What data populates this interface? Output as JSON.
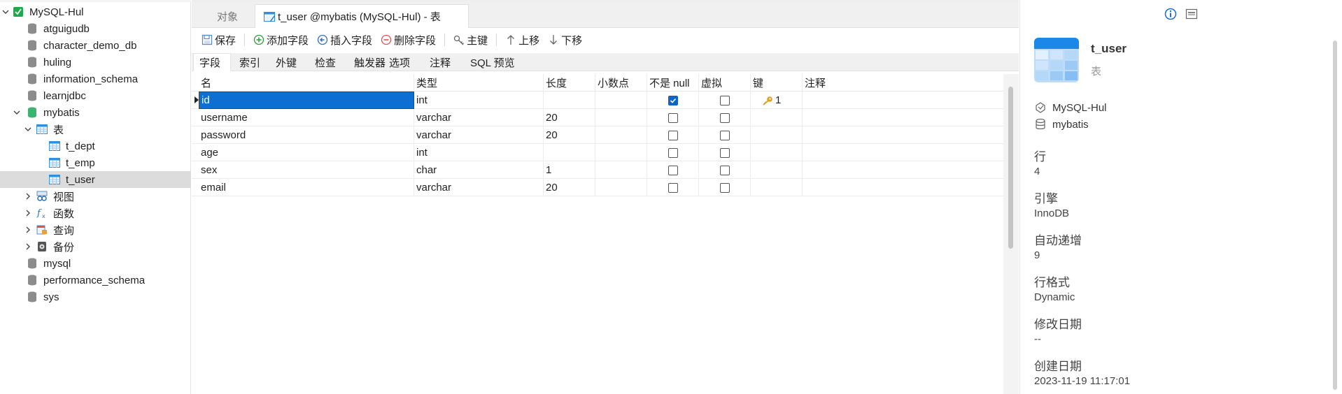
{
  "sidebar": {
    "connection": "MySQL-Hul",
    "items": [
      {
        "label": "atguigudb"
      },
      {
        "label": "character_demo_db"
      },
      {
        "label": "huling"
      },
      {
        "label": "information_schema"
      },
      {
        "label": "learnjdbc"
      },
      {
        "label": "mybatis"
      },
      {
        "label": "表"
      },
      {
        "label": "t_dept"
      },
      {
        "label": "t_emp"
      },
      {
        "label": "t_user"
      },
      {
        "label": "视图"
      },
      {
        "label": "函数"
      },
      {
        "label": "查询"
      },
      {
        "label": "备份"
      },
      {
        "label": "mysql"
      },
      {
        "label": "performance_schema"
      },
      {
        "label": "sys"
      }
    ]
  },
  "tabs": {
    "objects": "对象",
    "active": "t_user @mybatis (MySQL-Hul) - 表"
  },
  "toolbar": {
    "save": "保存",
    "add_field": "添加字段",
    "insert_field": "插入字段",
    "delete_field": "删除字段",
    "primary_key": "主键",
    "move_up": "上移",
    "move_down": "下移"
  },
  "subtabs": [
    "字段",
    "索引",
    "外键",
    "检查",
    "触发器",
    "选项",
    "注释",
    "SQL 预览"
  ],
  "grid": {
    "headers": [
      "名",
      "类型",
      "长度",
      "小数点",
      "不是 null",
      "虚拟",
      "键",
      "注释"
    ],
    "rows": [
      {
        "name": "id",
        "type": "int",
        "length": "",
        "decimal": "",
        "not_null": true,
        "virtual": false,
        "key": "1",
        "comment": ""
      },
      {
        "name": "username",
        "type": "varchar",
        "length": "20",
        "decimal": "",
        "not_null": false,
        "virtual": false,
        "key": "",
        "comment": ""
      },
      {
        "name": "password",
        "type": "varchar",
        "length": "20",
        "decimal": "",
        "not_null": false,
        "virtual": false,
        "key": "",
        "comment": ""
      },
      {
        "name": "age",
        "type": "int",
        "length": "",
        "decimal": "",
        "not_null": false,
        "virtual": false,
        "key": "",
        "comment": ""
      },
      {
        "name": "sex",
        "type": "char",
        "length": "1",
        "decimal": "",
        "not_null": false,
        "virtual": false,
        "key": "",
        "comment": ""
      },
      {
        "name": "email",
        "type": "varchar",
        "length": "20",
        "decimal": "",
        "not_null": false,
        "virtual": false,
        "key": "",
        "comment": ""
      }
    ]
  },
  "info": {
    "title": "t_user",
    "subtitle": "表",
    "connection": "MySQL-Hul",
    "database": "mybatis",
    "rows_label": "行",
    "rows_value": "4",
    "engine_label": "引擎",
    "engine_value": "InnoDB",
    "autoinc_label": "自动递增",
    "autoinc_value": "9",
    "rowformat_label": "行格式",
    "rowformat_value": "Dynamic",
    "modified_label": "修改日期",
    "modified_value": "--",
    "created_label": "创建日期",
    "created_value": "2023-11-19 11:17:01"
  },
  "colors": {
    "selection": "#0c6fd1",
    "table_icon": "#2f8fe0",
    "db_green": "#3cb371",
    "key_gold": "#e0a020",
    "add_green": "#2a9d3a",
    "delete_red": "#d9534f"
  }
}
